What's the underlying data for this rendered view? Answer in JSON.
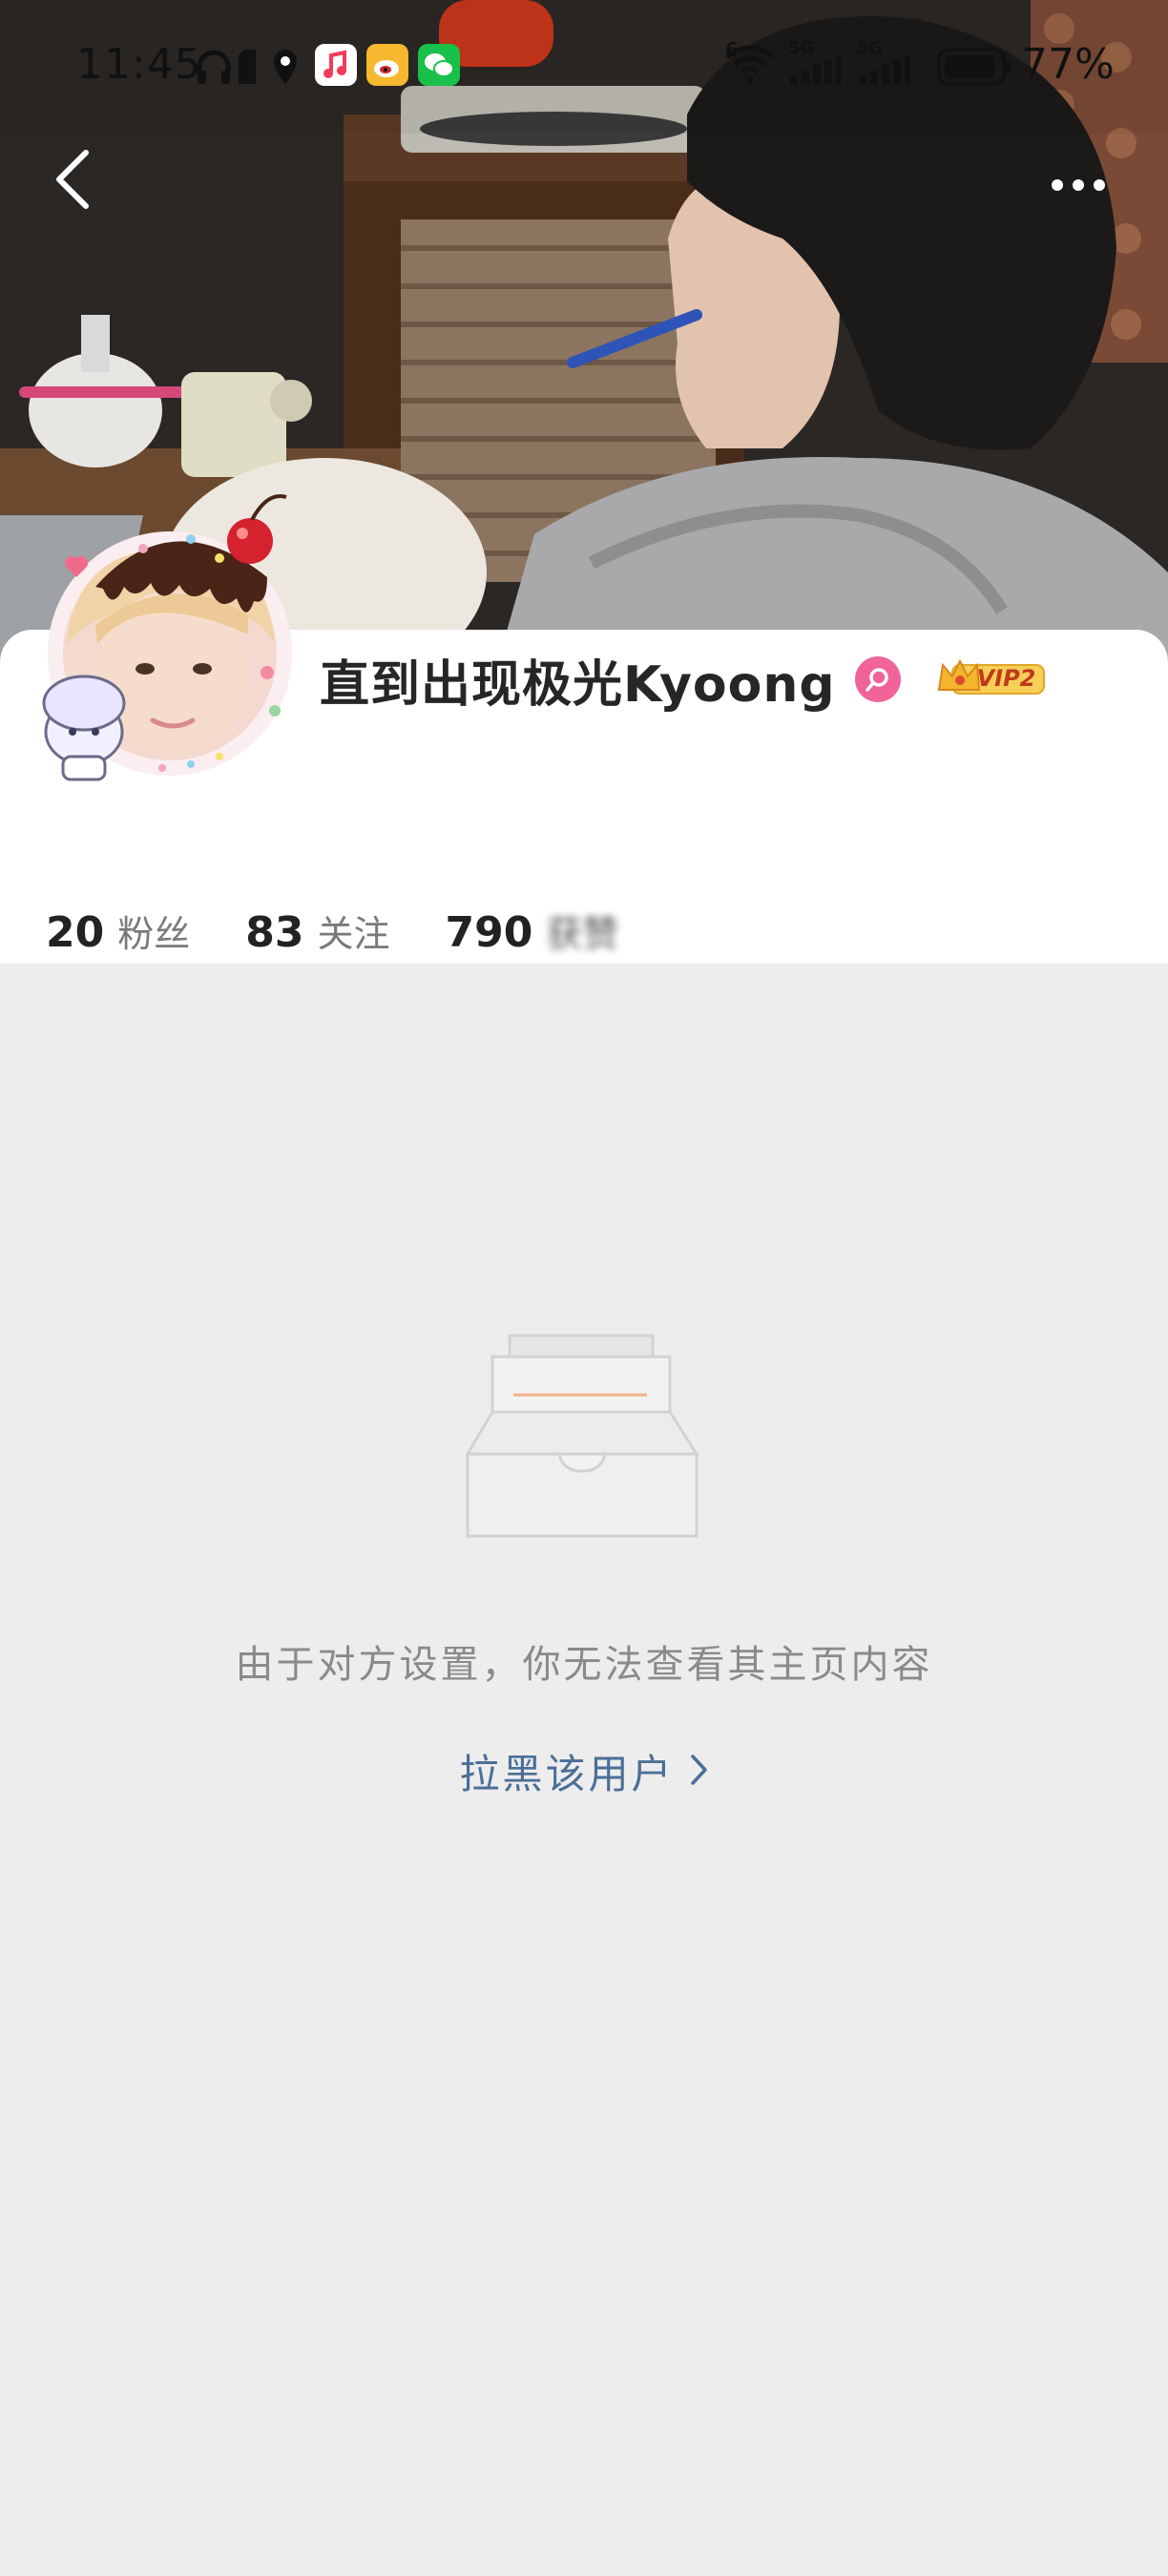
{
  "status_bar": {
    "time": "11:45",
    "battery_percent": "77%",
    "network_labels": [
      "5G",
      "5G"
    ],
    "wifi_badge": "6",
    "left_icons": [
      "headphones-icon",
      "sim-icon",
      "location-icon",
      "music-app-icon",
      "weibo-app-icon",
      "wechat-app-icon"
    ],
    "right_icons": [
      "wifi-icon",
      "signal-icon",
      "signal-icon",
      "battery-icon"
    ]
  },
  "navigation": {
    "back_icon": "chevron-left-icon",
    "more_icon": "more-horizontal-icon"
  },
  "profile": {
    "nickname": "直到出现极光Kyoong",
    "badges": {
      "search_badge_icon": "search-badge-icon",
      "vip_label": "VIP2",
      "vip_icon": "crown-icon"
    },
    "stats": [
      {
        "value": "20",
        "label": "粉丝"
      },
      {
        "value": "83",
        "label": "关注"
      },
      {
        "value": "790",
        "label": "获赞"
      }
    ]
  },
  "empty_state": {
    "illustration_icon": "empty-inbox-icon",
    "message": "由于对方设置，你无法查看其主页内容",
    "action_label": "拉黑该用户",
    "action_icon": "chevron-right-icon"
  },
  "colors": {
    "page_background": "#ededed",
    "card_background": "#ffffff",
    "link": "#4b6f98",
    "muted_text": "#8a8a8a",
    "vip_gold": "#f5c242",
    "badge_pink": "#f0649a"
  }
}
